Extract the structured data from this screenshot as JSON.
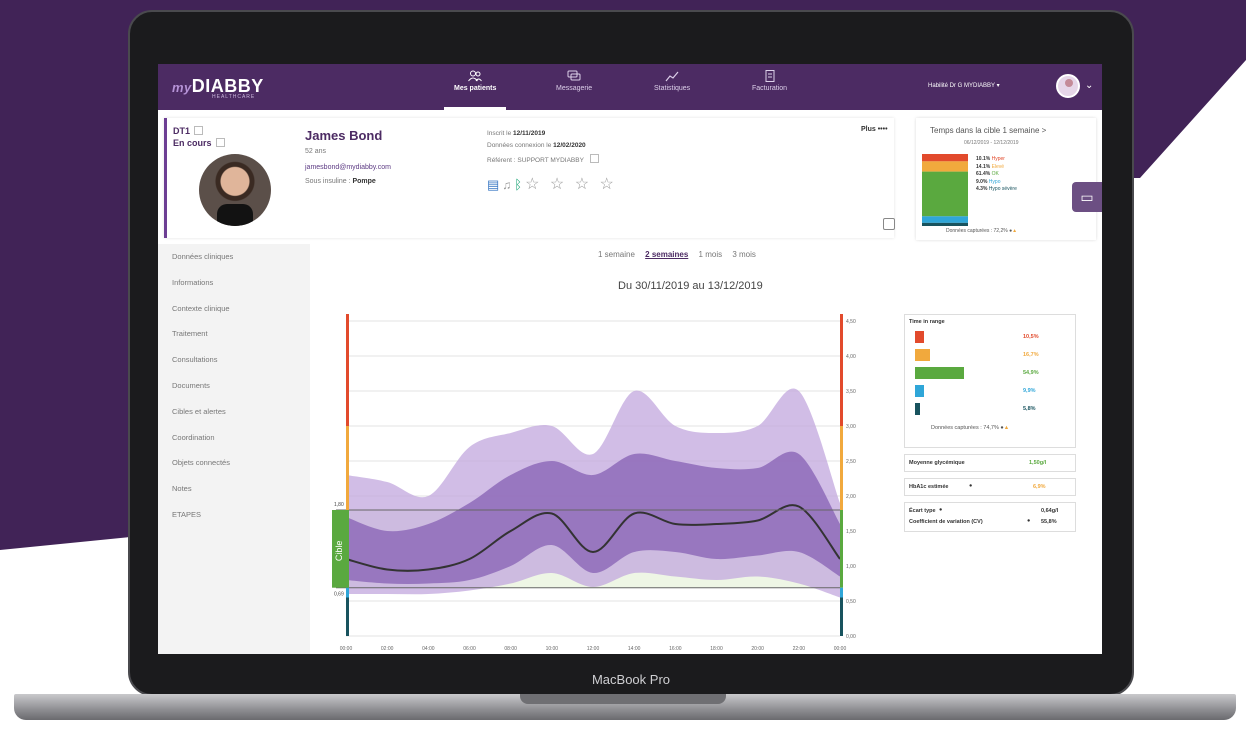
{
  "colors": {
    "brand_purple": "#4c2b63",
    "background_purple": "#412357",
    "very_high": "#e24a2c",
    "high": "#f1a93d",
    "in_range": "#5aa93f",
    "low": "#2fa6d8",
    "very_low": "#18535e",
    "band_outer": "#c2a7dd",
    "band_inner": "#8e6bb8",
    "median": "#333333"
  },
  "device": {
    "label": "MacBook Pro"
  },
  "topbar": {
    "logo_prefix": "my",
    "logo_main": "DIABBY",
    "logo_sub": "HEALTHCARE",
    "nav": [
      {
        "label": "Mes patients",
        "icon": "patients-icon",
        "active": true
      },
      {
        "label": "Messagerie",
        "icon": "messaging-icon",
        "active": false
      },
      {
        "label": "Statistiques",
        "icon": "statistics-icon",
        "active": false
      },
      {
        "label": "Facturation",
        "icon": "billing-icon",
        "active": false
      }
    ],
    "user_name": "Habilité Dr G MYDIABBY ▾"
  },
  "patient": {
    "diagnosis": "DT1",
    "status": "En cours",
    "name": "James Bond",
    "age": "52 ans",
    "email": "jamesbond@mydiabby.com",
    "insulin_label": "Sous insuline :",
    "insulin_value": "Pompe",
    "registered_label": "Inscrit le",
    "registered_value": "12/11/2019",
    "last_data_label": "Données connexion le",
    "last_data_value": "12/02/2020",
    "referent_label": "Référent :",
    "referent_value": "SUPPORT MYDIABBY",
    "more_label": "Plus ••••",
    "stars": "☆ ☆ ☆ ☆"
  },
  "tir_summary": {
    "title": "Temps dans la cible 1 semaine",
    "chevron": ">",
    "dates": "06/12/2019 - 12/12/2019",
    "rows": [
      {
        "value": "10.1%",
        "label": "Hyper",
        "color": "#e24a2c"
      },
      {
        "value": "14.1%",
        "label": "Elevé",
        "color": "#f1a93d"
      },
      {
        "value": "61.4%",
        "label": "OK",
        "color": "#5aa93f"
      },
      {
        "value": "9.0%",
        "label": "Hypo",
        "color": "#2fa6d8"
      },
      {
        "value": "4.3%",
        "label": "Hypo sévère",
        "color": "#18535e"
      }
    ],
    "captured": "Données capturées : 72,2%"
  },
  "sidebar": {
    "items": [
      "Données cliniques",
      "Informations",
      "Contexte clinique",
      "Traitement",
      "Consultations",
      "Documents",
      "Cibles et alertes",
      "Coordination",
      "Objets connectés",
      "Notes",
      "ETAPES"
    ]
  },
  "periods": [
    "1 semaine",
    "2 semaines",
    "1 mois",
    "3 mois"
  ],
  "selected_period": "2 semaines",
  "date_range": "Du 30/11/2019 au 13/12/2019",
  "chart_data": {
    "type": "area",
    "title": "Du 30/11/2019 au 13/12/2019",
    "xlabel": "",
    "ylabel": "",
    "x_ticks": [
      "00:00",
      "02:00",
      "04:00",
      "06:00",
      "08:00",
      "10:00",
      "12:00",
      "14:00",
      "16:00",
      "18:00",
      "20:00",
      "22:00",
      "00:00"
    ],
    "y_ticks": [
      "0,00",
      "0,50",
      "1,00",
      "1,50",
      "2,00",
      "2,50",
      "3,00",
      "3,50",
      "4,00",
      "4,50"
    ],
    "ylim": [
      0,
      4.6
    ],
    "target_label": "Cible",
    "target_low_label": "0,69",
    "target_high_label": "1,80",
    "target_low": 0.69,
    "target_high": 1.8,
    "x_hours": [
      0,
      2,
      4,
      6,
      8,
      10,
      12,
      14,
      16,
      18,
      20,
      22,
      24
    ],
    "series": [
      {
        "name": "p90",
        "values": [
          2.3,
          2.2,
          2.0,
          2.7,
          2.9,
          3.0,
          2.6,
          3.5,
          3.0,
          2.9,
          3.0,
          3.5,
          1.9
        ]
      },
      {
        "name": "p75",
        "values": [
          1.7,
          1.5,
          1.6,
          1.9,
          2.3,
          2.5,
          2.3,
          2.6,
          2.5,
          2.4,
          2.4,
          2.6,
          1.6
        ]
      },
      {
        "name": "median",
        "values": [
          1.1,
          0.95,
          0.95,
          1.1,
          1.5,
          1.75,
          1.2,
          1.75,
          1.6,
          1.6,
          1.65,
          1.85,
          1.1
        ]
      },
      {
        "name": "p25",
        "values": [
          0.8,
          0.75,
          0.75,
          0.8,
          1.0,
          1.3,
          0.9,
          1.2,
          1.2,
          1.1,
          1.15,
          1.2,
          0.85
        ]
      },
      {
        "name": "p10",
        "values": [
          0.6,
          0.6,
          0.6,
          0.65,
          0.75,
          0.9,
          0.7,
          0.9,
          0.85,
          0.8,
          0.85,
          0.75,
          0.55
        ]
      }
    ]
  },
  "stats_panel": {
    "tir_title": "Time in range",
    "tir_values": [
      {
        "value": "10,5%",
        "fraction": 0.105,
        "color": "#e24a2c"
      },
      {
        "value": "16,7%",
        "fraction": 0.167,
        "color": "#f1a93d"
      },
      {
        "value": "54,9%",
        "fraction": 0.549,
        "color": "#5aa93f"
      },
      {
        "value": "9,9%",
        "fraction": 0.099,
        "color": "#2fa6d8"
      },
      {
        "value": "5,8%",
        "fraction": 0.058,
        "color": "#18535e"
      }
    ],
    "captured": "Données capturées : 74,7%",
    "mean_label": "Moyenne glycémique",
    "mean_value": "1,50g/l",
    "hba1c_label": "HbA1c estimée",
    "hba1c_value": "6,9%",
    "sd_label": "Écart type",
    "sd_value": "0,64g/l",
    "cv_label": "Coefficient de variation (CV)",
    "cv_value": "55,8%"
  }
}
